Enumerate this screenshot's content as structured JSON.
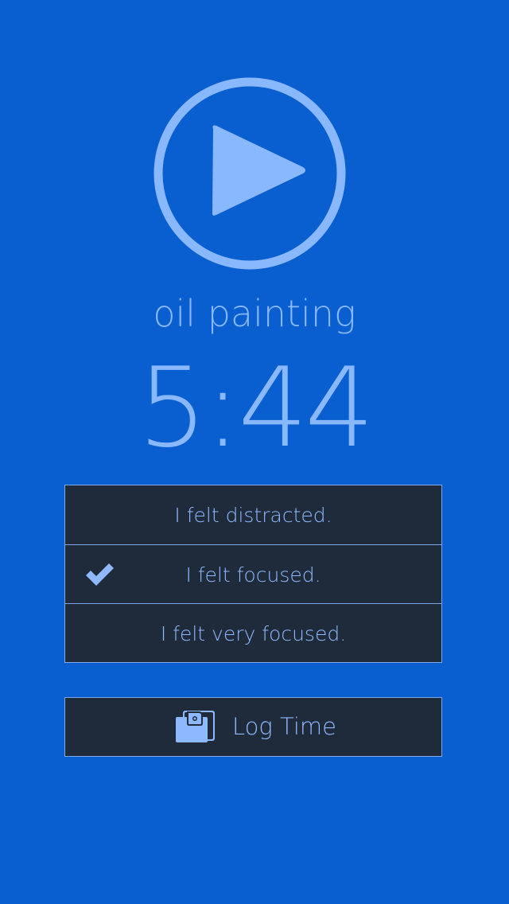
{
  "player": {
    "icon": "play-icon",
    "activity": "oil painting",
    "time": "5:44"
  },
  "focus_options": [
    {
      "label": "I felt distracted.",
      "checked": false
    },
    {
      "label": "I felt focused.",
      "checked": true
    },
    {
      "label": "I felt very focused."
    }
  ],
  "log_button": {
    "icon": "wallet-icon",
    "label": "Log Time"
  },
  "colors": {
    "background": "#0a5fd0",
    "accent": "#89b8ff",
    "panel": "#1f2a3a",
    "border": "#7ea8e8"
  }
}
